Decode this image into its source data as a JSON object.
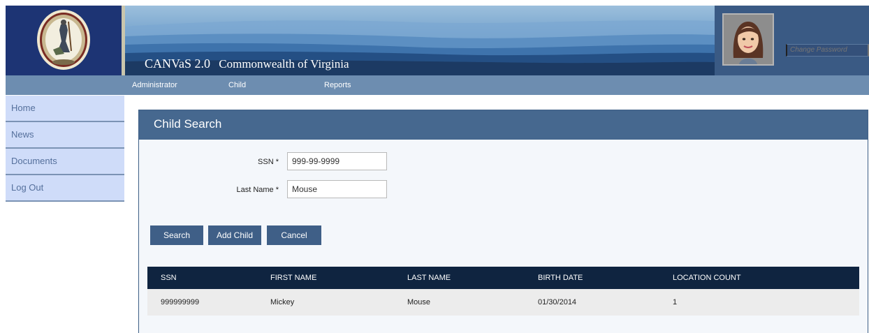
{
  "header": {
    "app_name": "CANVaS 2.0",
    "subtitle": "Commonwealth of Virginia",
    "change_password_placeholder": "Change Password"
  },
  "nav": {
    "items": [
      "Administrator",
      "Child",
      "Reports"
    ]
  },
  "sidebar": {
    "items": [
      "Home",
      "News",
      "Documents",
      "Log Out"
    ]
  },
  "panel": {
    "title": "Child Search",
    "fields": {
      "ssn": {
        "label": "SSN *",
        "value": "999-99-9999"
      },
      "last_name": {
        "label": "Last Name *",
        "value": "Mouse"
      }
    },
    "buttons": {
      "search": "Search",
      "add_child": "Add Child",
      "cancel": "Cancel"
    }
  },
  "results": {
    "columns": [
      "SSN",
      "FIRST NAME",
      "LAST NAME",
      "BIRTH DATE",
      "LOCATION COUNT"
    ],
    "rows": [
      [
        "999999999",
        "Mickey",
        "Mouse",
        "01/30/2014",
        "1"
      ]
    ]
  },
  "colors": {
    "header_navy": "#1d3474",
    "nav_blue": "#6d8db0",
    "panel_title": "#46688f",
    "button": "#3f5f87",
    "table_head": "#0f2440",
    "sidebar_bg": "#cfdcf9"
  },
  "icons": [
    "virginia-seal-logo",
    "user-avatar"
  ]
}
